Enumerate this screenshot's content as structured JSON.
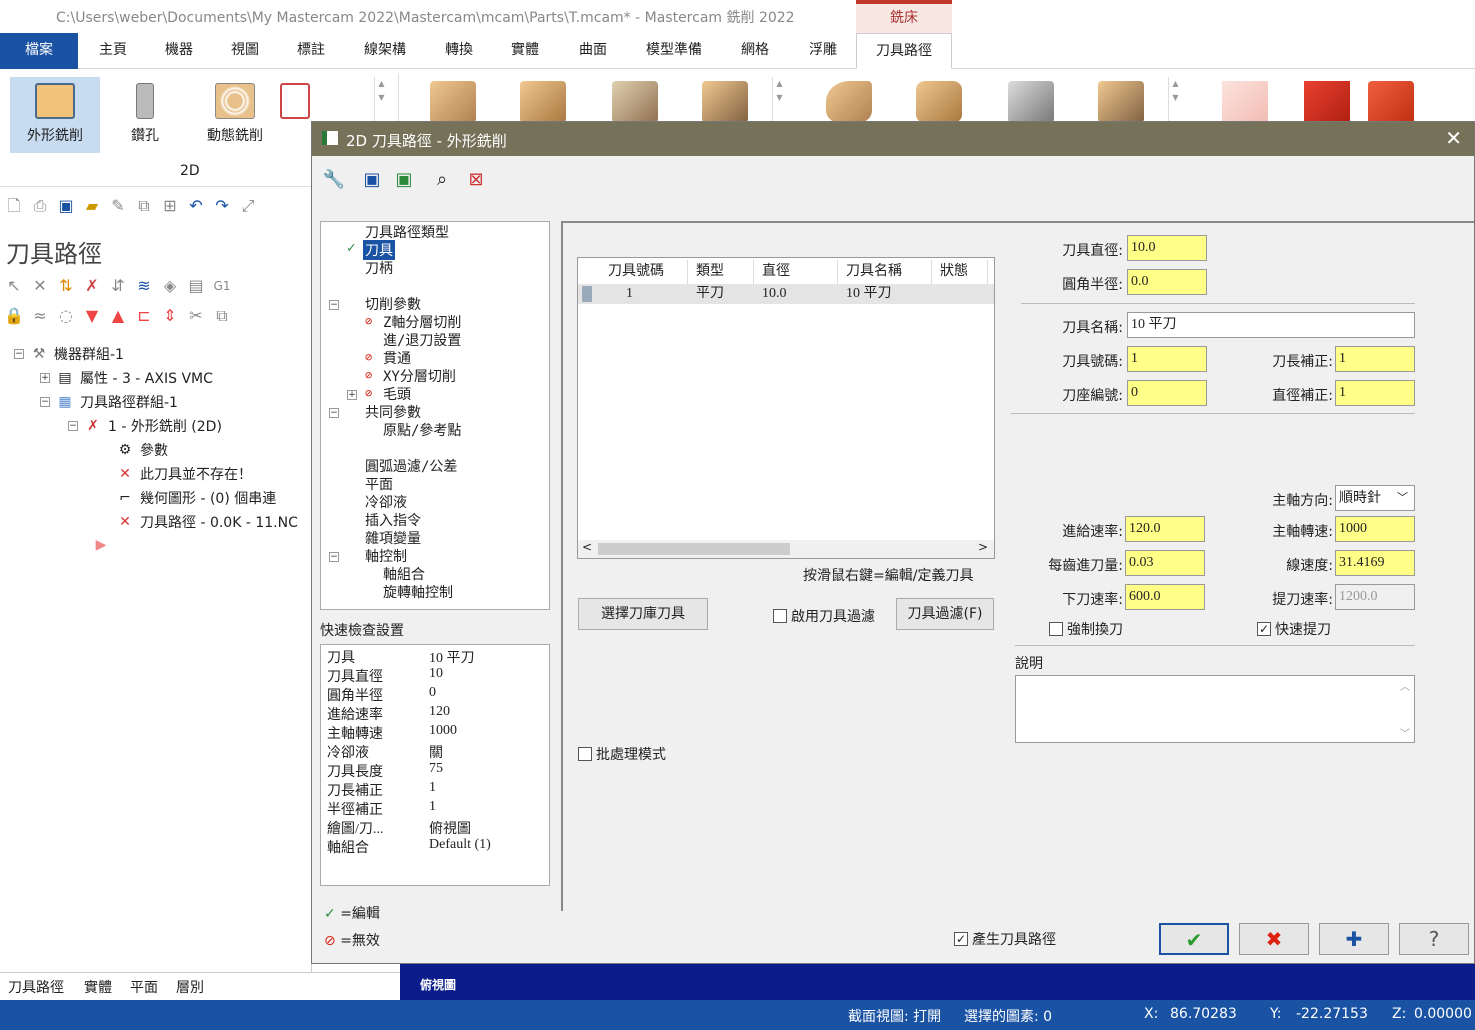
{
  "window": {
    "title": "C:\\Users\\weber\\Documents\\My Mastercam 2022\\Mastercam\\mcam\\Parts\\T.mcam* - Mastercam 銑削 2022",
    "context_tab": "銑床"
  },
  "ribbon_tabs": [
    "檔案",
    "主頁",
    "機器",
    "視圖",
    "標註",
    "線架構",
    "轉換",
    "實體",
    "曲面",
    "模型準備",
    "網格",
    "浮雕",
    "刀具路徑"
  ],
  "ribbon": {
    "buttons": [
      "外形銑削",
      "鑽孔",
      "動態銑削"
    ],
    "group_label": "2D"
  },
  "left_panel": {
    "title": "刀具路徑",
    "tree": [
      "機器群組-1",
      "屬性 - 3 - AXIS VMC",
      "刀具路徑群組-1",
      "1 - 外形銑削 (2D)",
      "參數",
      "此刀具並不存在！",
      "幾何圖形 - (0) 個串連",
      "刀具路徑 - 0.0K - 11.NC"
    ],
    "g1": "G1"
  },
  "bottom_tabs": [
    "刀具路徑",
    "實體",
    "平面",
    "層別"
  ],
  "view_label": "俯視圖",
  "status": {
    "section": "截面視圖: 打開",
    "selected": "選擇的圖素: 0",
    "x_label": "X:",
    "x": "86.70283",
    "y_label": "Y:",
    "y": "-22.27153",
    "z_label": "Z:",
    "z": "0.00000"
  },
  "dialog": {
    "title": "2D 刀具路徑 - 外形銑削",
    "nav": [
      "刀具路徑類型",
      "刀具",
      "刀柄",
      "切削參數",
      "Z軸分層切削",
      "進/退刀設置",
      "貫通",
      "XY分層切削",
      "毛頭",
      "共同參數",
      "原點/參考點",
      "圓弧過濾/公差",
      "平面",
      "冷卻液",
      "插入指令",
      "雜項變量",
      "軸控制",
      "軸組合",
      "旋轉軸控制"
    ],
    "quick_check_label": "快速檢查設置",
    "quick_check": [
      {
        "k": "刀具",
        "v": "10 平刀"
      },
      {
        "k": "刀具直徑",
        "v": "10"
      },
      {
        "k": "圓角半徑",
        "v": "0"
      },
      {
        "k": "進給速率",
        "v": "120"
      },
      {
        "k": "主軸轉速",
        "v": "1000"
      },
      {
        "k": "冷卻液",
        "v": "關"
      },
      {
        "k": "刀具長度",
        "v": "75"
      },
      {
        "k": "刀長補正",
        "v": "1"
      },
      {
        "k": "半徑補正",
        "v": "1"
      },
      {
        "k": "繪圖/刀...",
        "v": "俯視圖"
      },
      {
        "k": "軸組合",
        "v": "Default (1)"
      }
    ],
    "legend": {
      "edit": "=編輯",
      "invalid": "=無效"
    },
    "grid": {
      "headers": [
        "刀具號碼",
        "類型",
        "直徑",
        "刀具名稱",
        "狀態"
      ],
      "row": [
        "1",
        "平刀",
        "10.0",
        "10 平刀",
        ""
      ]
    },
    "hint": "按滑鼠右鍵=編輯/定義刀具",
    "select_lib_btn": "選擇刀庫刀具",
    "enable_filter": "啟用刀具過濾",
    "filter_btn": "刀具過濾(F)",
    "batch": "批處理模式",
    "fields": {
      "tool_dia_label": "刀具直徑:",
      "tool_dia": "10.0",
      "corner_rad_label": "圓角半徑:",
      "corner_rad": "0.0",
      "tool_name_label": "刀具名稱:",
      "tool_name": "10 平刀",
      "tool_num_label": "刀具號碼:",
      "tool_num": "1",
      "len_comp_label": "刀長補正:",
      "len_comp": "1",
      "holder_num_label": "刀座編號:",
      "holder_num": "0",
      "dia_comp_label": "直徑補正:",
      "dia_comp": "1",
      "spindle_dir_label": "主軸方向:",
      "spindle_dir": "順時針",
      "feed_label": "進給速率:",
      "feed": "120.0",
      "spindle_label": "主軸轉速:",
      "spindle": "1000",
      "fpt_label": "每齒進刀量:",
      "fpt": "0.03",
      "surf_speed_label": "線速度:",
      "surf_speed": "31.4169",
      "plunge_label": "下刀速率:",
      "plunge": "600.0",
      "retract_label": "提刀速率:",
      "retract": "1200.0",
      "force_change": "強制換刀",
      "rapid_retract": "快速提刀",
      "comment_label": "說明"
    },
    "generate": "產生刀具路徑"
  }
}
